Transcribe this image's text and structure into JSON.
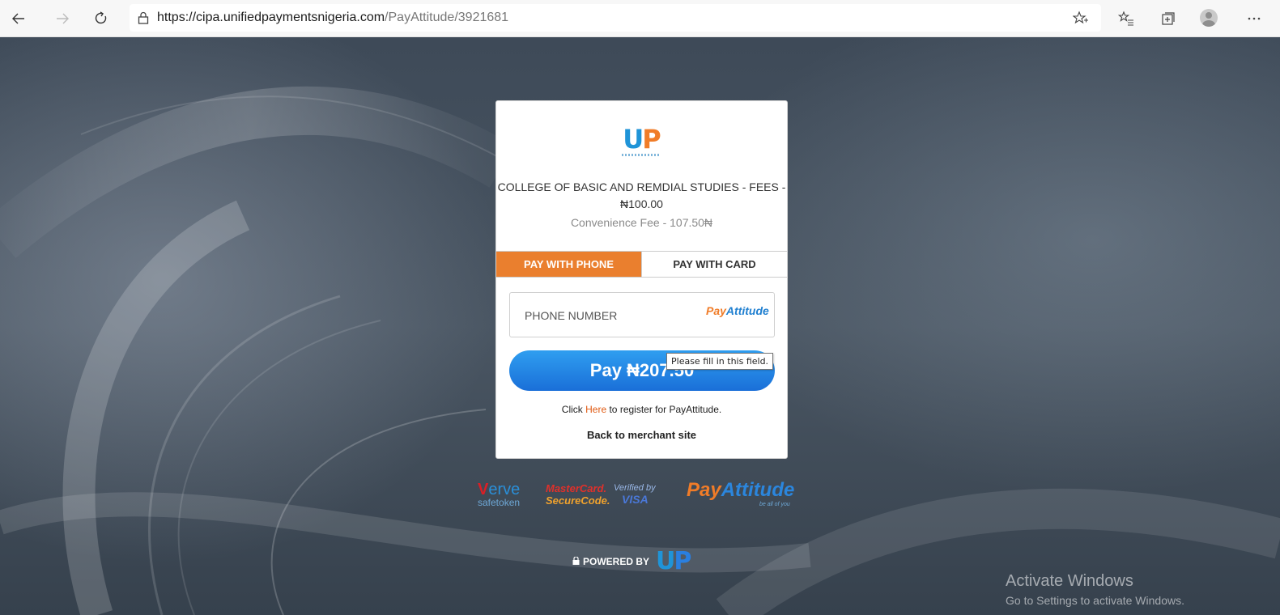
{
  "browser": {
    "url_host": "https://cipa.unifiedpaymentsnigeria.com",
    "url_path": "/PayAttitude/3921681",
    "icons": [
      "back-arrow-icon",
      "forward-arrow-icon",
      "refresh-icon",
      "lock-icon",
      "favorite-star-icon",
      "favorites-list-icon",
      "collections-icon",
      "profile-avatar",
      "more-icon"
    ]
  },
  "card": {
    "logo": "UP",
    "merchant_line": "COLLEGE OF BASIC AND REMDIAL STUDIES - FEES - ₦100.00",
    "convenience_fee": "Convenience Fee - 107.50₦",
    "tabs": [
      {
        "label": "PAY WITH PHONE",
        "active": true
      },
      {
        "label": "PAY WITH CARD",
        "active": false
      }
    ],
    "phone_placeholder": "PHONE NUMBER",
    "payattitude_pay": "Pay",
    "payattitude_attitude": "Attitude",
    "tooltip": "Please fill in this field.",
    "pay_button": "Pay ₦207.50",
    "register_prefix": "Click ",
    "register_link": "Here",
    "register_suffix": " to register for PayAttitude.",
    "back_link": "Back to merchant site"
  },
  "footer": {
    "verve_v": "V",
    "verve_rest": "erve",
    "verve_sub": "safetoken",
    "mastercard_1": "MasterCard.",
    "mastercard_2": "SecureCode.",
    "vbv_1": "Verified by",
    "vbv_2": "VISA",
    "pa_pay": "Pay",
    "pa_attitude": "Attitude",
    "pa_tagline": "be all of you",
    "powered_by": "POWERED BY",
    "powered_logo": "UP"
  },
  "watermark": {
    "title": "Activate Windows",
    "subtitle": "Go to Settings to activate Windows."
  },
  "colors": {
    "accent_orange": "#ea7f2e",
    "pay_button_blue": "#1a6fd8",
    "link_orange": "#e05a12"
  }
}
